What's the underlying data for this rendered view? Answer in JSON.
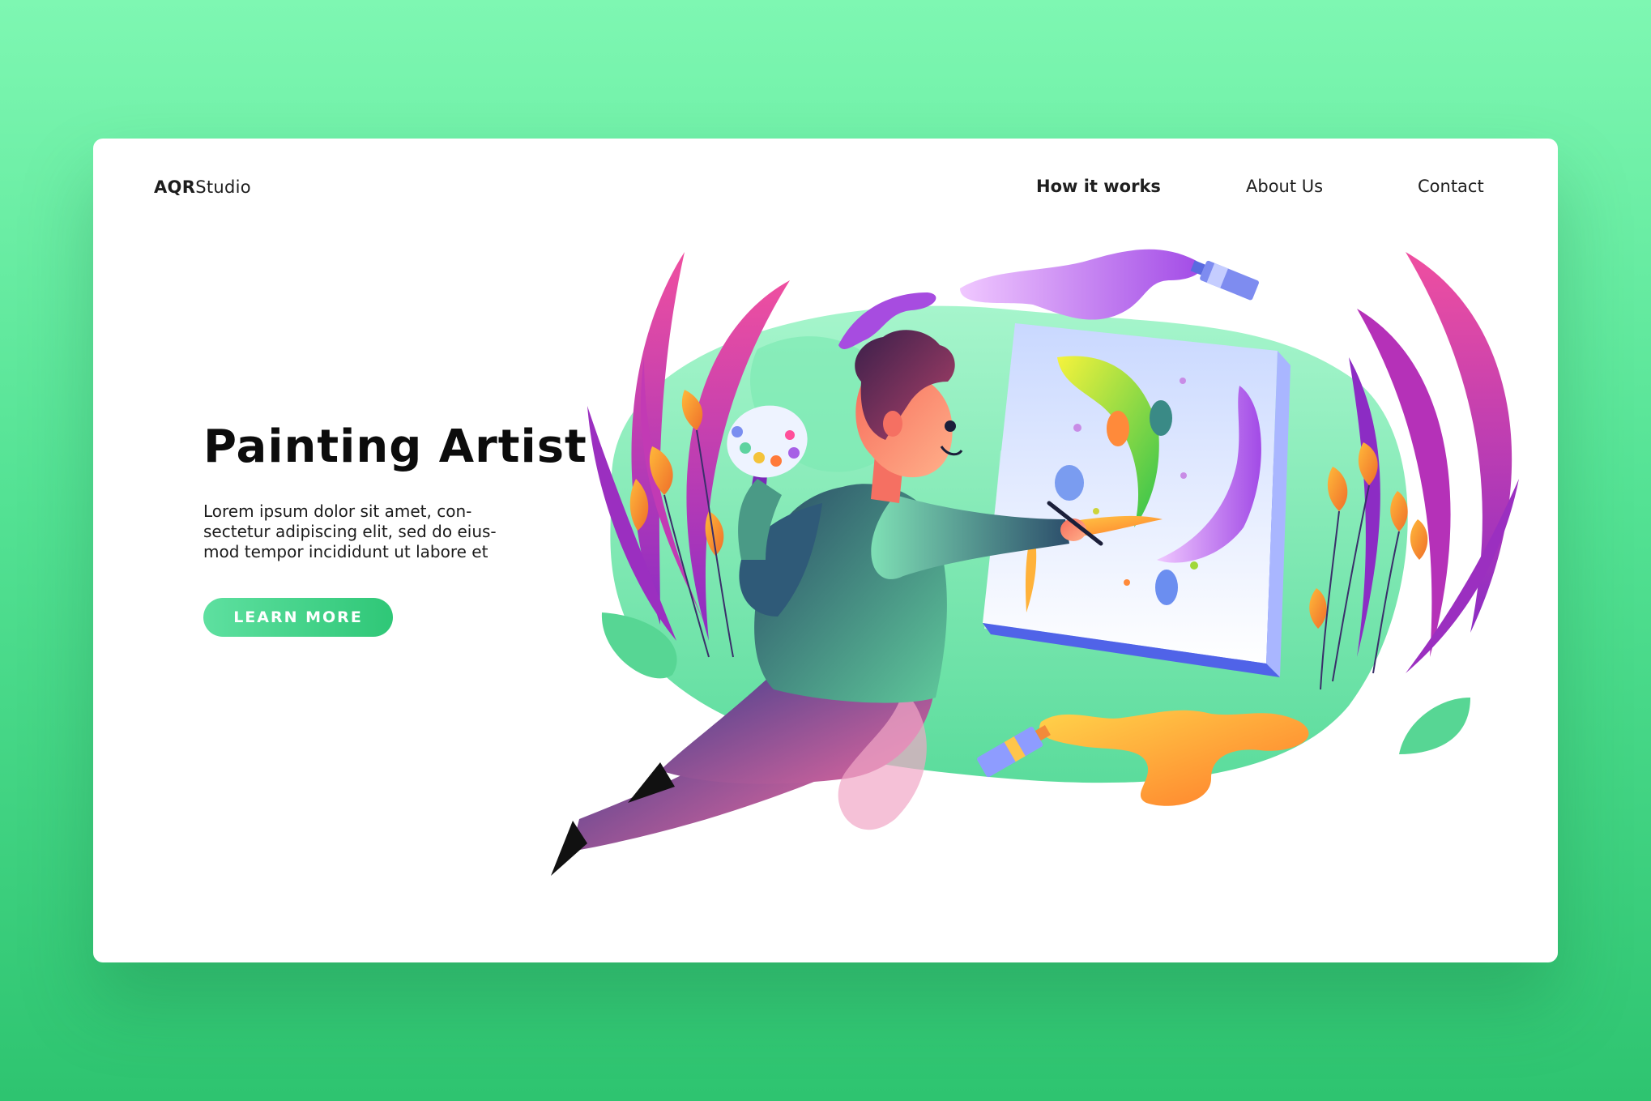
{
  "brand": {
    "bold": "AQR",
    "light": "Studio"
  },
  "nav": {
    "items": [
      {
        "label": "How it works",
        "active": true
      },
      {
        "label": "About Us",
        "active": false
      },
      {
        "label": "Contact",
        "active": false
      }
    ]
  },
  "hero": {
    "title": "Painting Artist",
    "body_lines": [
      "Lorem ipsum dolor sit amet, con-",
      "sectetur adipiscing elit, sed do eius-",
      "mod tempor incididunt ut labore et"
    ],
    "cta_label": "LEARN MORE"
  },
  "colors": {
    "background_top": "#7ef7b2",
    "background_bottom": "#2ec470",
    "accent_green": "#2fc777",
    "accent_purple": "#9b2fc0",
    "accent_pink": "#ee4d9b",
    "accent_orange": "#f79a2a"
  },
  "illustration": {
    "subject": "painter-at-easel-icon"
  }
}
